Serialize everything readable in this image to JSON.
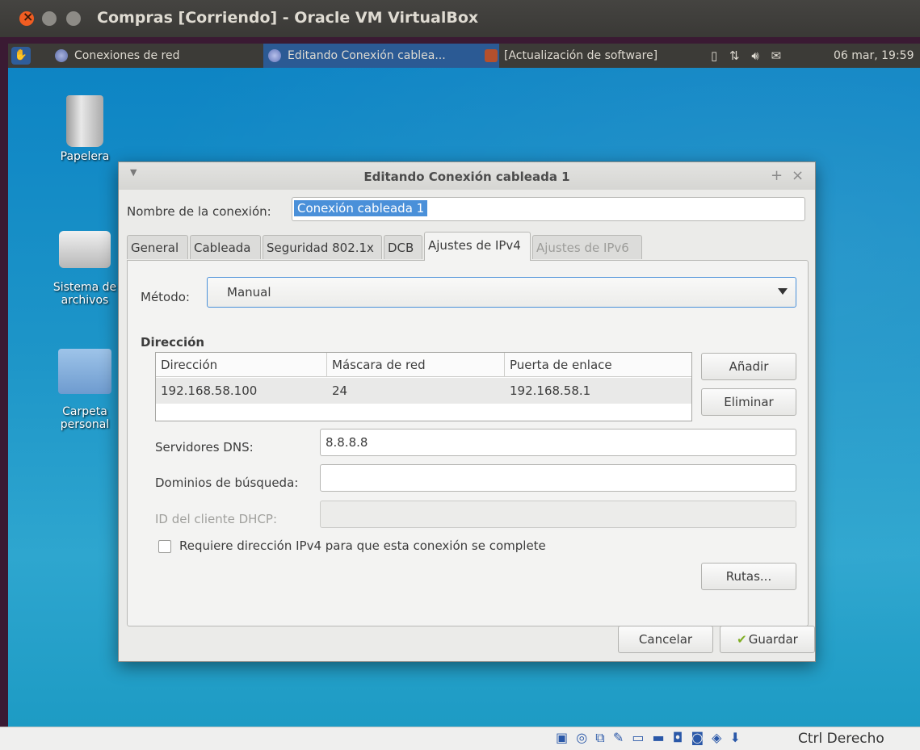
{
  "host": {
    "title": "Compras [Corriendo] - Oracle VM VirtualBox",
    "host_key": "Ctrl Derecho",
    "status_icons": [
      "hard-disk-icon",
      "optical-disk-icon",
      "network-icon",
      "usb-icon",
      "shared-folder-icon",
      "display-icon",
      "video-capture-icon",
      "vm-icon",
      "mouse-integration-icon",
      "arrow-down-icon"
    ]
  },
  "panel": {
    "tasks": [
      {
        "label": "Conexiones de red"
      },
      {
        "label": "Editando Conexión cablea..."
      },
      {
        "label": "[Actualización de software]"
      }
    ],
    "clock": "06 mar, 19:59",
    "indicators": [
      "battery-icon",
      "network-arrows-icon",
      "volume-icon",
      "mail-icon"
    ]
  },
  "desktop": {
    "icons": [
      {
        "label": "Papelera"
      },
      {
        "label": "Sistema de archivos"
      },
      {
        "label": "Carpeta personal"
      }
    ]
  },
  "dialog": {
    "title": "Editando Conexión cableada 1",
    "connection_name_label": "Nombre de la conexión:",
    "connection_name_value": "Conexión cableada 1",
    "tabs": [
      {
        "label": "General"
      },
      {
        "label": "Cableada"
      },
      {
        "label": "Seguridad 802.1x"
      },
      {
        "label": "DCB"
      },
      {
        "label": "Ajustes de IPv4",
        "active": true
      },
      {
        "label": "Ajustes de IPv6",
        "disabled": true
      }
    ],
    "method_label": "Método:",
    "method_value": "Manual",
    "address_section_title": "Dirección",
    "address_table": {
      "columns": [
        "Dirección",
        "Máscara de red",
        "Puerta de enlace"
      ],
      "rows": [
        [
          "192.168.58.100",
          "24",
          "192.168.58.1"
        ]
      ]
    },
    "add_label": "Añadir",
    "delete_label": "Eliminar",
    "dns_label": "Servidores DNS:",
    "dns_value": "8.8.8.8",
    "search_domains_label": "Dominios de búsqueda:",
    "search_domains_value": "",
    "dhcp_client_id_label": "ID del cliente DHCP:",
    "dhcp_client_id_value": "",
    "require_ipv4_label": "Requiere dirección IPv4 para que esta conexión se complete",
    "require_ipv4_checked": false,
    "routes_label": "Rutas...",
    "cancel_label": "Cancelar",
    "save_label": "Guardar"
  }
}
